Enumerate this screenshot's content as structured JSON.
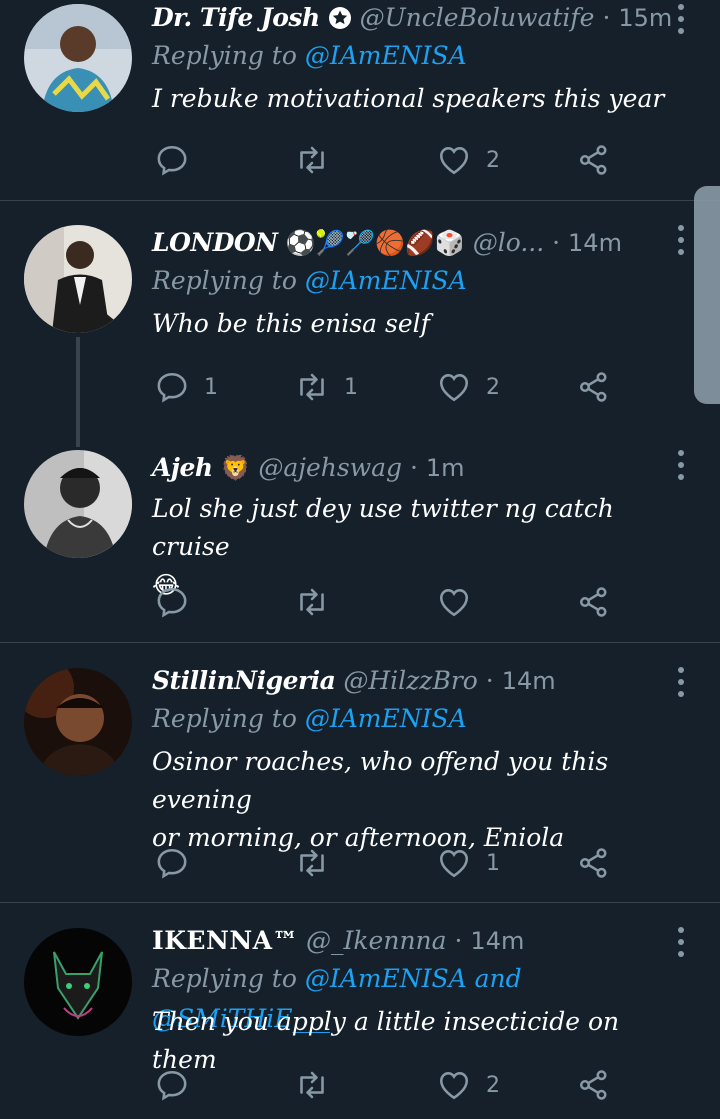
{
  "colors": {
    "background": "#15202b",
    "divider": "#38444d",
    "secondary_text": "#8899a6",
    "mention": "#1da1f2"
  },
  "tweets": [
    {
      "name": "Dr. Tife Josh",
      "badge_icon": "star-badge-icon",
      "handle": "@UncleBoluwatife",
      "time": "15m",
      "replying_prefix": "Replying to",
      "mention": "@IAmENISA",
      "text": "I rebuke motivational speakers this year",
      "reply_count": "",
      "retweet_count": "",
      "like_count": "2"
    },
    {
      "name": "LONDON",
      "name_emojis": "⚽🎾🏸🏀🏈🎲",
      "handle": "@lo...",
      "time": "14m",
      "replying_prefix": "Replying to",
      "mention": "@IAmENISA",
      "text": "Who be this enisa self",
      "reply_count": "1",
      "retweet_count": "1",
      "like_count": "2"
    },
    {
      "name": "Ajeh",
      "name_emojis": "🦁",
      "handle": "@ajehswag",
      "time": "1m",
      "text": "Lol she just dey use twitter ng catch cruise",
      "text_emoji": "😂",
      "reply_count": "",
      "retweet_count": "",
      "like_count": ""
    },
    {
      "name": "StillinNigeria",
      "handle": "@Hilzz­Bro",
      "time": "14m",
      "replying_prefix": "Replying to",
      "mention": "@IAmENISA",
      "text_line1": "Osinor roaches, who offend you this evening",
      "text_line2": "or morning, or afternoon, Eniola",
      "reply_count": "",
      "retweet_count": "",
      "like_count": "1"
    },
    {
      "name": "IKENNA™",
      "handle": "@_Ikennna",
      "time": "14m",
      "replying_prefix": "Replying to",
      "mention": "@IAmENISA",
      "conjunction": "and",
      "mention2": "@SMiTHiE___",
      "text": "Then you apply a little insecticide on them",
      "reply_count": "",
      "retweet_count": "",
      "like_count": "2"
    }
  ]
}
